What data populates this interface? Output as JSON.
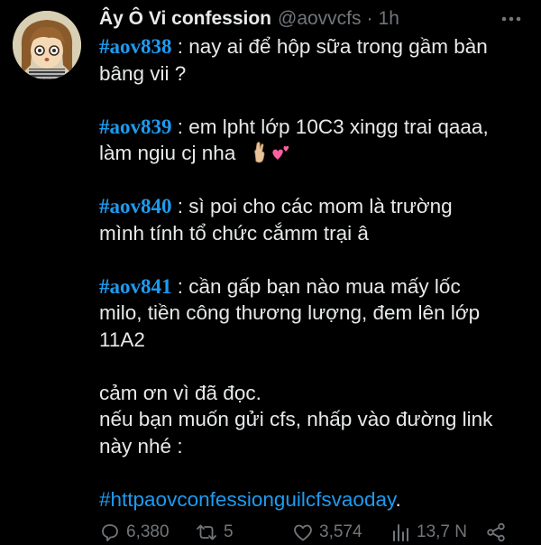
{
  "tweet": {
    "author_name": "Ây Ô Vi confession",
    "handle": "@aovvcfs",
    "separator": "·",
    "time": "1h",
    "posts": [
      {
        "tag": "#aov838",
        "lines": [
          " : nay ai để hộp sữa trong gầm bàn",
          "bâng vii ?"
        ]
      },
      {
        "tag": "#aov839",
        "lines": [
          " : em lpht lớp 10C3 xingg trai qaaa,",
          "làm ngiu cj nha"
        ]
      },
      {
        "tag": "#aov840",
        "lines": [
          " : sì poi cho các mom là trường",
          "mình tính tổ chức cắmm trại â"
        ]
      },
      {
        "tag": "#aov841",
        "lines": [
          " : cần gấp bạn nào mua mấy lốc",
          "milo, tiền công thương lượng, đem lên lớp",
          "11A2"
        ]
      }
    ],
    "outro_lines": [
      "cảm ơn vì đã đọc.",
      "nếu bạn muốn gửi cfs, nhấp vào đường link",
      "này nhé :"
    ],
    "link_text": "#httpaovconfessionguilcfsvaoday",
    "link_suffix": ".",
    "stats": {
      "replies": "6,380",
      "retweets": "5",
      "likes": "3,574",
      "views": "13,7 N"
    }
  },
  "icons": {
    "more": "more-horizontal-icon",
    "reply": "reply-icon",
    "retweet": "retweet-icon",
    "like": "heart-icon",
    "views": "views-chart-icon",
    "share": "share-icon",
    "emoji_1": "crossed-fingers-emoji",
    "emoji_2": "two-hearts-emoji"
  },
  "colors": {
    "background": "#000000",
    "text": "#e7e9ea",
    "muted": "#71767b",
    "accent": "#1d9bf0"
  }
}
